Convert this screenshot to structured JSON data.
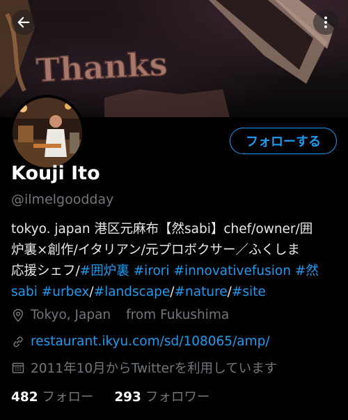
{
  "header": {
    "back_icon": "arrow-left-icon",
    "more_icon": "more-vertical-icon",
    "banner_text": "Thanks"
  },
  "profile": {
    "follow_label": "フォローする",
    "display_name": "Kouji Ito",
    "handle": "@ilmelgoodday",
    "bio": {
      "line1": "tokyo. japan 港区元麻布【然sabi】chef/owner/囲",
      "line2": "炉裏×創作/イタリアン/元プロボクサー／ふくしま",
      "line3_text": "応援シェフ/",
      "line3_tag1": "#囲炉裏",
      "line3_tag2": "#irori",
      "line3_tag3": "#innovativefusion",
      "line3_tag4": "#然",
      "line4_tag1": "sabi",
      "line4_tag2": "#urbex",
      "line4_sep1": "/",
      "line4_tag3": "#landscape",
      "line4_sep2": "/",
      "line4_tag4": "#nature",
      "line4_sep3": "/",
      "line4_tag5": "#site"
    },
    "location": "Tokyo, Japan",
    "from": "from Fukushima",
    "url": "restaurant.ikyu.com/sd/108065/amp/",
    "joined": "2011年10月からTwitterを利用しています",
    "following_count": "482",
    "following_label": "フォロー",
    "followers_count": "293",
    "followers_label": "フォロワー"
  },
  "colors": {
    "accent": "#1d9bf0",
    "muted": "#71767b",
    "background": "#000000"
  }
}
